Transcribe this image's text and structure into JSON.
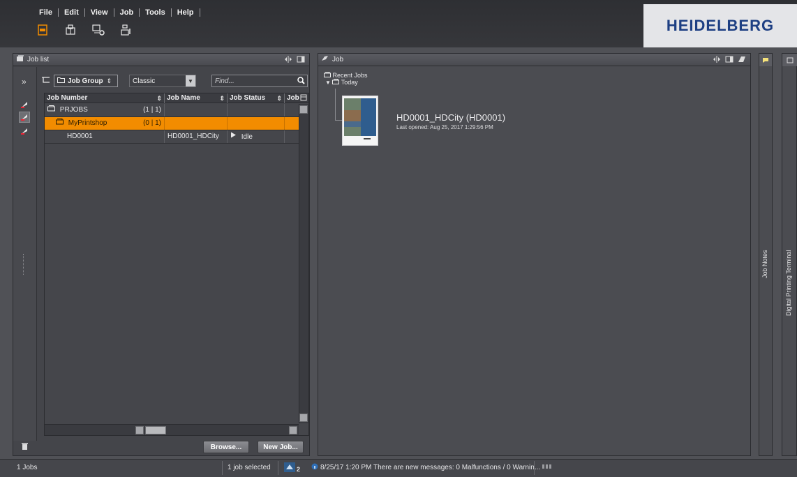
{
  "menu": [
    "File",
    "Edit",
    "View",
    "Job",
    "Tools",
    "Help"
  ],
  "toolbar_icons": [
    "job-icon",
    "printer-icon",
    "computer-settings-icon",
    "workflow-icon"
  ],
  "brand": "HEIDELBERG",
  "joblist": {
    "title": "Job list",
    "group_select": "Job Group",
    "view_select": "Classic",
    "find_placeholder": "Find...",
    "columns": [
      "Job Number",
      "Job Name",
      "Job Status",
      "Job"
    ],
    "rows": [
      {
        "number": "PRJOBS",
        "count": "(1 | 1)",
        "name": "",
        "status": "",
        "level": 0,
        "selected": false
      },
      {
        "number": "MyPrintshop",
        "count": "(0 | 1)",
        "name": "",
        "status": "",
        "level": 1,
        "selected": true
      },
      {
        "number": "HD0001",
        "count": "",
        "name": "HD0001_HDCity",
        "status": "Idle",
        "level": 2,
        "selected": false
      }
    ],
    "browse_label": "Browse...",
    "newjob_label": "New Job..."
  },
  "job": {
    "title": "Job",
    "recent_jobs": "Recent Jobs",
    "today": "Today",
    "job_title": "HD0001_HDCity (HD0001)",
    "last_opened": "Last opened: Aug 25, 2017 1:29:56 PM"
  },
  "side_panels": {
    "job_notes": "Job Notes",
    "dpt": "Digital Printing Terminal"
  },
  "status": {
    "jobs_count": "1 Jobs",
    "selected": "1 job selected",
    "badge": "2",
    "message": "8/25/17 1:20 PM  There are new messages: 0 Malfunctions / 0 Warnin..."
  },
  "colors": {
    "accent_orange": "#f28c00",
    "brand_blue": "#1d3f83"
  }
}
